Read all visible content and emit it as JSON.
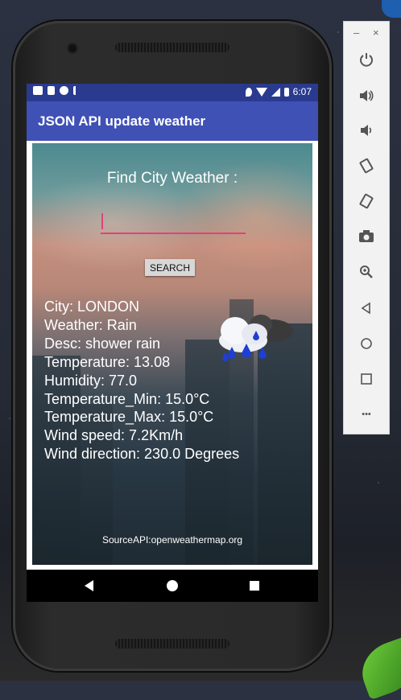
{
  "statusbar": {
    "time": "6:07"
  },
  "app": {
    "title": "JSON API update weather"
  },
  "form": {
    "heading": "Find City Weather :",
    "city_value": "",
    "search_label": "SEARCH"
  },
  "weather": {
    "city": "City: LONDON",
    "weather": "Weather: Rain",
    "desc": "Desc: shower rain",
    "temperature": "Temperature: 13.08",
    "humidity": "Humidity: 77.0",
    "temp_min": "Temperature_Min: 15.0°C",
    "temp_max": "Temperature_Max: 15.0°C",
    "wind_speed": "Wind speed: 7.2Km/h",
    "wind_direction": "Wind direction: 230.0 Degrees",
    "icon": "rain-cloud-icon"
  },
  "footer": {
    "source": "SourceAPI:openweathermap.org"
  },
  "toolbar": {
    "minimize": "–",
    "close": "×",
    "more": "•••"
  },
  "colors": {
    "appbar": "#3f51b5",
    "statusbar": "#2a3a8f",
    "input_underline": "#e0427a"
  }
}
